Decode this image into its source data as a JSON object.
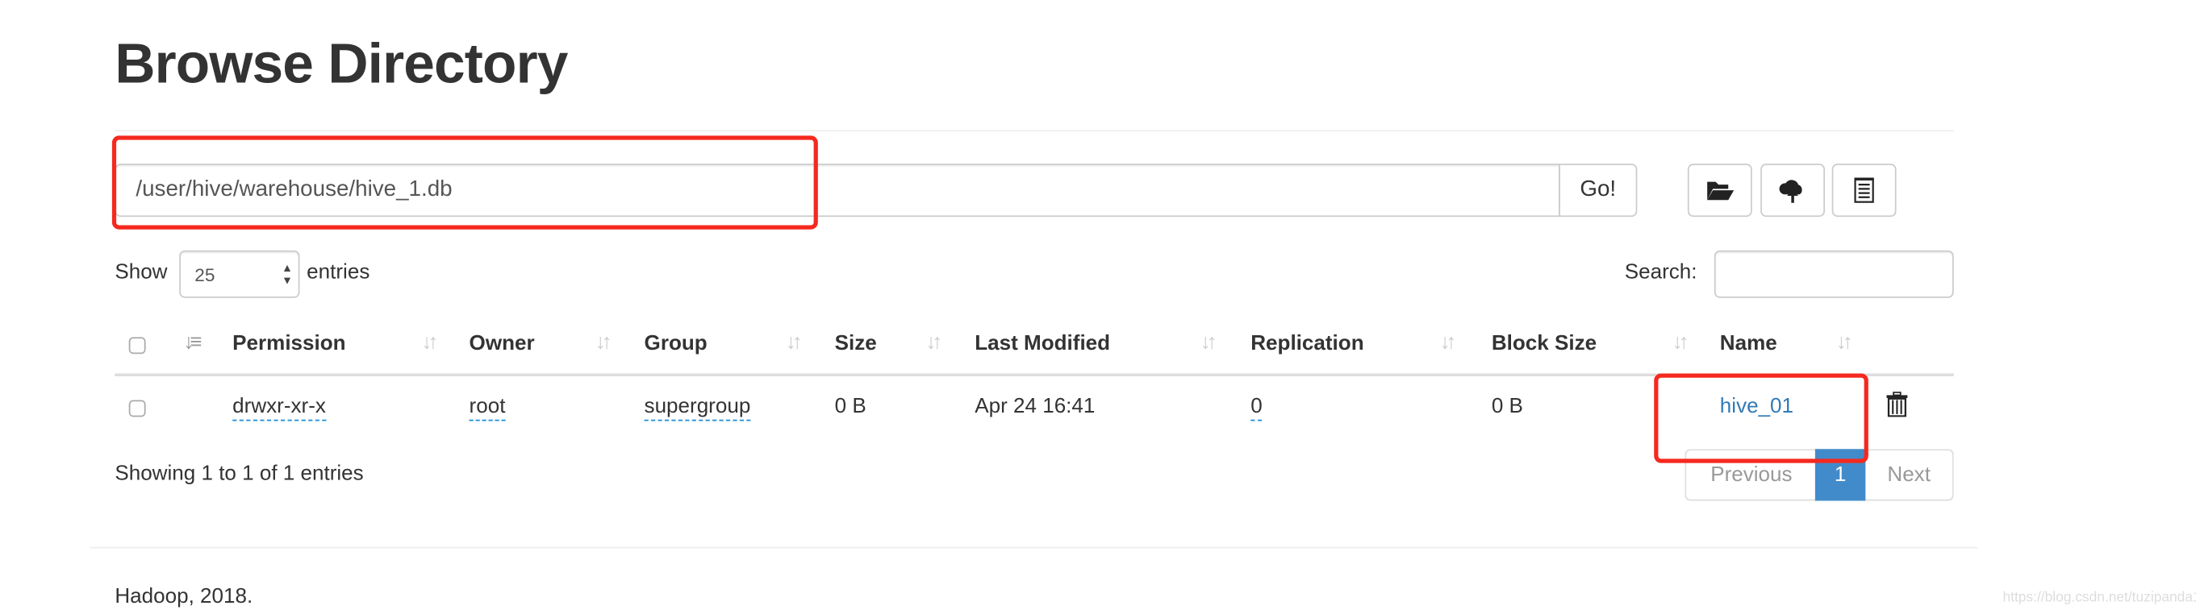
{
  "page_title": "Browse Directory",
  "path_input": {
    "value": "/user/hive/warehouse/hive_1.db"
  },
  "go_button": "Go!",
  "toolbar": {
    "icons": [
      "folder-open-icon",
      "cloud-upload-icon",
      "list-icon"
    ]
  },
  "length_menu": {
    "show_label": "Show",
    "selected": "25",
    "entries_label": "entries"
  },
  "search": {
    "label": "Search:",
    "value": ""
  },
  "table": {
    "columns": [
      "Permission",
      "Owner",
      "Group",
      "Size",
      "Last Modified",
      "Replication",
      "Block Size",
      "Name"
    ],
    "rows": [
      {
        "permission": "drwxr-xr-x",
        "owner": "root",
        "group": "supergroup",
        "size": "0 B",
        "last_modified": "Apr 24 16:41",
        "replication": "0",
        "block_size": "0 B",
        "name": "hive_01"
      }
    ]
  },
  "info": "Showing 1 to 1 of 1 entries",
  "pagination": {
    "previous": "Previous",
    "current": "1",
    "next": "Next"
  },
  "footer": "Hadoop, 2018.",
  "watermark": "https://blog.csdn.net/tuzipanda11",
  "colors": {
    "highlight": "#f5291f",
    "link": "#337ab7",
    "active_page": "#428bca"
  }
}
